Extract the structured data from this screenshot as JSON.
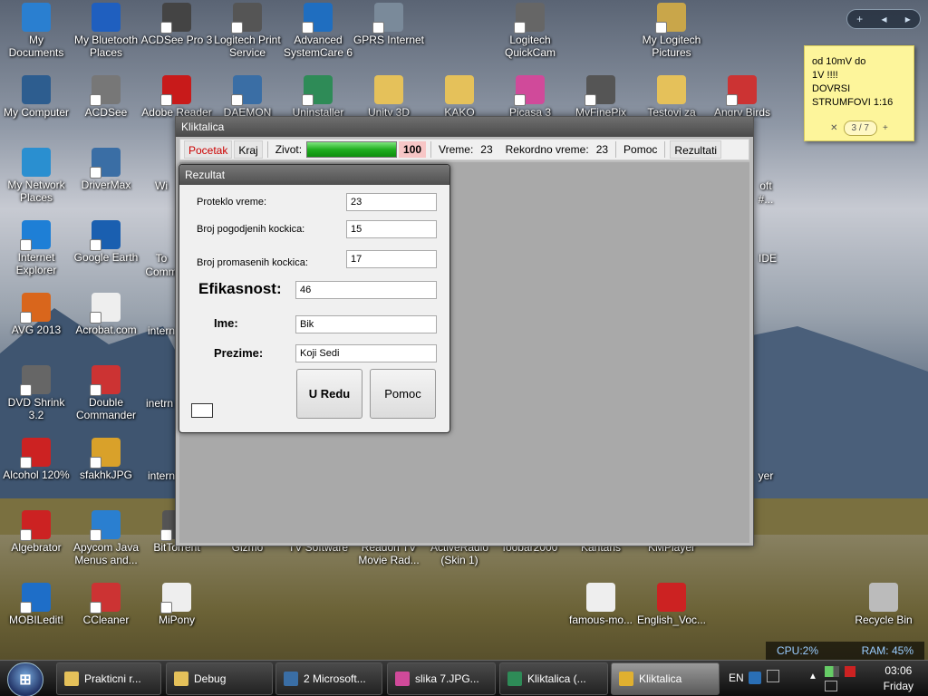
{
  "desktop": {
    "icons": [
      {
        "label": "My Documents",
        "color": "#2a7fd0"
      },
      {
        "label": "My Bluetooth Places",
        "color": "#1f5fbf"
      },
      {
        "label": "ACDSee Pro 3",
        "color": "#444"
      },
      {
        "label": "Logitech Print Service",
        "color": "#555"
      },
      {
        "label": "Advanced SystemCare 6",
        "color": "#1f6ec0"
      },
      {
        "label": "GPRS Internet",
        "color": "#7a8a9a"
      },
      {
        "label": "Logitech QuickCam",
        "color": "#666"
      },
      {
        "label": "My Logitech Pictures",
        "color": "#c9a64a"
      },
      {
        "label": "My Computer",
        "color": "#2d5d8f"
      },
      {
        "label": "ACDSee",
        "color": "#777"
      },
      {
        "label": "Adobe Reader",
        "color": "#c81a1a"
      },
      {
        "label": "DAEMON",
        "color": "#3a6ea5"
      },
      {
        "label": "Uninstaller",
        "color": "#2e8b57"
      },
      {
        "label": "Unity 3D",
        "color": "#e5c15a"
      },
      {
        "label": "KAKO",
        "color": "#e5c15a"
      },
      {
        "label": "Picasa 3",
        "color": "#d04a9a"
      },
      {
        "label": "MyFinePix",
        "color": "#555"
      },
      {
        "label": "Testovi za",
        "color": "#e5c15a"
      },
      {
        "label": "Angry Birds",
        "color": "#c33"
      },
      {
        "label": "My Network Places",
        "color": "#2a8fd0"
      },
      {
        "label": "DriverMax",
        "color": "#3a6ea5"
      },
      {
        "label": "Internet Explorer",
        "color": "#1e7fd6"
      },
      {
        "label": "Google Earth",
        "color": "#1a5fb0"
      },
      {
        "label": "AVG 2013",
        "color": "#d9661c"
      },
      {
        "label": "Acrobat.com",
        "color": "#eee"
      },
      {
        "label": "DVD Shrink 3.2",
        "color": "#666"
      },
      {
        "label": "Double Commander",
        "color": "#c33"
      },
      {
        "label": "Alcohol 120%",
        "color": "#c22"
      },
      {
        "label": "sfakhkJPG",
        "color": "#d9a12a"
      },
      {
        "label": "Algebrator",
        "color": "#c22"
      },
      {
        "label": "Apycom Java Menus and...",
        "color": "#2a7fd0"
      },
      {
        "label": "BitTorrent",
        "color": "#555"
      },
      {
        "label": "Gizmo",
        "color": "#555"
      },
      {
        "label": "TV Software",
        "color": "#555"
      },
      {
        "label": "Readon TV Movie Rad...",
        "color": "#555"
      },
      {
        "label": "ActiveRadio (Skin 1)",
        "color": "#555"
      },
      {
        "label": "foobar2000",
        "color": "#555"
      },
      {
        "label": "Kantaris",
        "color": "#555"
      },
      {
        "label": "KMPlayer",
        "color": "#555"
      },
      {
        "label": "MOBILedit!",
        "color": "#1e6ec8"
      },
      {
        "label": "CCleaner",
        "color": "#c33"
      },
      {
        "label": "MiPony",
        "color": "#eee"
      },
      {
        "label": "famous-mo...",
        "color": "#eee"
      },
      {
        "label": "English_Voc...",
        "color": "#c22"
      },
      {
        "label": "Recycle Bin",
        "color": "#bbb"
      }
    ],
    "partial_labels": {
      "wi": "Wi",
      "tc": "To",
      "tc2": "Comm",
      "int1": "intern",
      "int2": "inetrn",
      "int3": "intern",
      "soft": "oft",
      "soft2": "#...",
      "ide": "IDE",
      "yer": "yer"
    }
  },
  "gadget": {
    "add": "+",
    "prev": "◂",
    "next": "▸"
  },
  "note": {
    "lines": [
      "od 10mV do",
      "1V  !!!!",
      "DOVRSI",
      "STRUMFOVI  1:16"
    ],
    "page": "3 / 7",
    "close": "✕",
    "add": "+"
  },
  "window": {
    "title": "Kliktalica",
    "toolbar": {
      "start": "Pocetak",
      "end": "Kraj",
      "life_label": "Zivot:",
      "life_value": "100",
      "life_fraction": 1.0,
      "time_label": "Vreme:",
      "time_value": "23",
      "record_label": "Rekordno vreme:",
      "record_value": "23",
      "help": "Pomoc",
      "results": "Rezultati"
    }
  },
  "dialog": {
    "title": "Rezultat",
    "elapsed_label": "Proteklo vreme:",
    "elapsed_value": "23",
    "hit_label": "Broj pogodjenih kockica:",
    "hit_value": "15",
    "miss_label": "Broj promasenih kockica:",
    "miss_value": "17",
    "eff_label": "Efikasnost:",
    "eff_value": "46",
    "name_label": "Ime:",
    "name_value": "Bik",
    "surname_label": "Prezime:",
    "surname_value": "Koji Sedi",
    "ok": "U Redu",
    "help": "Pomoc"
  },
  "cpu": {
    "cpu_label": "CPU:",
    "cpu_value": "2%",
    "ram_label": "RAM:",
    "ram_value": "45%"
  },
  "taskbar": {
    "start": "⊞",
    "tasks": [
      {
        "label": "Prakticni r...",
        "color": "#e5c15a"
      },
      {
        "label": "Debug",
        "color": "#e5c15a"
      },
      {
        "label": "2 Microsoft...",
        "color": "#3a6ea5"
      },
      {
        "label": "slika 7.JPG...",
        "color": "#d04a9a"
      },
      {
        "label": "Kliktalica (...",
        "color": "#2e8b57"
      },
      {
        "label": "Kliktalica",
        "color": "#e0b030"
      }
    ],
    "lang": "EN",
    "time": "03:06",
    "day": "Friday"
  }
}
